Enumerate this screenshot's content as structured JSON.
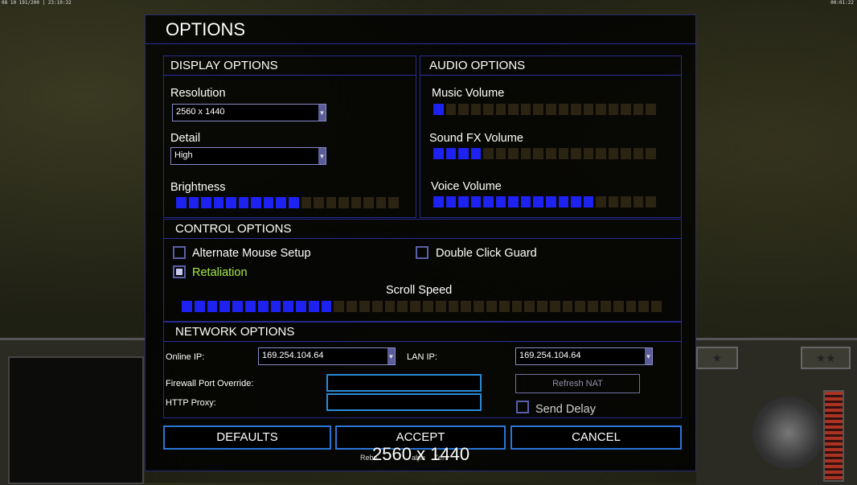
{
  "hud": {
    "top_left": "08 10 191/200 | 23:10:32",
    "top_right": "00:01:22"
  },
  "dialog": {
    "title": "OPTIONS"
  },
  "display": {
    "header": "DISPLAY OPTIONS",
    "resolution_label": "Resolution",
    "resolution_value": "2560 x 1440",
    "detail_label": "Detail",
    "detail_value": "High",
    "brightness_label": "Brightness",
    "brightness_level": {
      "filled": 10,
      "total": 18
    }
  },
  "audio": {
    "header": "AUDIO OPTIONS",
    "music_label": "Music Volume",
    "music_level": {
      "filled": 1,
      "total": 18
    },
    "sfx_label": "Sound FX Volume",
    "sfx_level": {
      "filled": 4,
      "total": 18
    },
    "voice_label": "Voice Volume",
    "voice_level": {
      "filled": 13,
      "total": 18
    }
  },
  "control": {
    "header": "CONTROL OPTIONS",
    "alt_mouse_label": "Alternate Mouse Setup",
    "alt_mouse_checked": false,
    "double_click_label": "Double Click Guard",
    "double_click_checked": false,
    "retaliation_label": "Retaliation",
    "retaliation_checked": true,
    "scroll_label": "Scroll Speed",
    "scroll_level": {
      "filled": 12,
      "total": 38
    }
  },
  "network": {
    "header": "NETWORK OPTIONS",
    "online_ip_label": "Online IP:",
    "online_ip_value": "169.254.104.64",
    "lan_ip_label": "LAN IP:",
    "lan_ip_value": "169.254.104.64",
    "firewall_label": "Firewall Port Override:",
    "firewall_value": "",
    "proxy_label": "HTTP Proxy:",
    "proxy_value": "",
    "refresh_nat_label": "Refresh NAT",
    "send_delay_label": "Send Delay",
    "send_delay_checked": false
  },
  "buttons": {
    "defaults": "DEFAULTS",
    "accept": "ACCEPT",
    "cancel": "CANCEL"
  },
  "footer": {
    "version_left": "Rebo",
    "version_mid": "alph",
    "version_right": "Zero",
    "resolution_overlay": "2560 x 1440"
  },
  "colors": {
    "slider_on": "#1e22f0",
    "slider_off": "#2b2412",
    "accent_border": "#2a76d8",
    "retaliation_text": "#a8e84a"
  }
}
